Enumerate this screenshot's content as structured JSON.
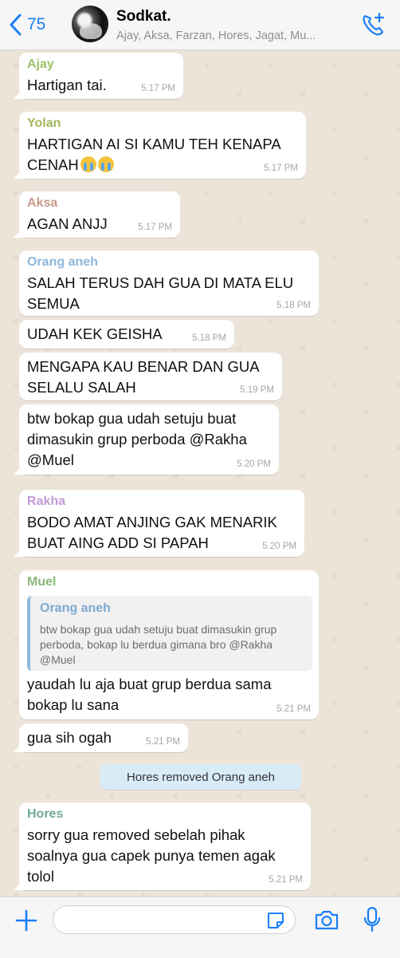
{
  "header": {
    "back_count": "75",
    "title": "Sodkat.",
    "members": "Ajay, Aksa, Farzan, Hores, Jagat, Mu..."
  },
  "messages": [
    {
      "sender": "Ajay",
      "sender_color": "#9fc06a",
      "lines": [
        "Hartigan tai."
      ],
      "time": "5.17 PM"
    },
    {
      "sender": "Yolan",
      "sender_color": "#a3b85c",
      "lines": [
        "HARTIGAN AI SI KAMU TEH KENAPA",
        "CENAH"
      ],
      "emojis": [
        "loudly-crying-face",
        "loudly-crying-face"
      ],
      "time": "5.17 PM"
    },
    {
      "sender": "Aksa",
      "sender_color": "#c79a8a",
      "lines": [
        "AGAN ANJJ"
      ],
      "time": "5.17 PM"
    },
    {
      "sender": "Orang aneh",
      "sender_color": "#8fb8db",
      "lines": [
        "SALAH TERUS DAH GUA DI MATA ELU",
        "SEMUA"
      ],
      "time": "5.18 PM"
    },
    {
      "lines": [
        "UDAH KEK GEISHA"
      ],
      "time": "5.18 PM"
    },
    {
      "lines": [
        "MENGAPA KAU BENAR DAN GUA",
        "SELALU SALAH"
      ],
      "time": "5.19 PM"
    },
    {
      "lines": [
        "btw bokap gua udah setuju buat",
        "dimasukin grup perboda @Rakha",
        "@Muel"
      ],
      "time": "5.20 PM"
    },
    {
      "sender": "Rakha",
      "sender_color": "#c49bd6",
      "lines": [
        "BODO AMAT ANJING GAK MENARIK",
        "BUAT AING ADD SI PAPAH"
      ],
      "time": "5.20 PM"
    },
    {
      "sender": "Muel",
      "sender_color": "#8bb87a",
      "quote": {
        "name": "Orang aneh",
        "text": "btw bokap gua udah setuju buat dimasukin grup perboda, bokap lu berdua gimana bro @Rakha @Muel"
      },
      "lines": [
        "yaudah lu aja buat grup berdua sama",
        "bokap lu sana"
      ],
      "time": "5.21 PM"
    },
    {
      "lines": [
        "gua sih ogah"
      ],
      "time": "5.21 PM"
    },
    {
      "sender": "Hores",
      "sender_color": "#6fa89a",
      "lines": [
        "sorry gua removed sebelah pihak",
        "soalnya gua capek punya temen agak",
        "tolol"
      ],
      "time": "5.21 PM"
    }
  ],
  "system_message": "Hores removed Orang aneh",
  "composer": {
    "placeholder": ""
  },
  "icons": {
    "back": "chevron-left-icon",
    "add_call": "phone-plus-icon",
    "attach": "plus-icon",
    "sticker": "sticker-icon",
    "camera": "camera-icon",
    "mic": "microphone-icon"
  },
  "colors": {
    "accent": "#1a7ef7",
    "chat_bg": "#ece4d9",
    "system_bg": "#d8ecf7"
  }
}
